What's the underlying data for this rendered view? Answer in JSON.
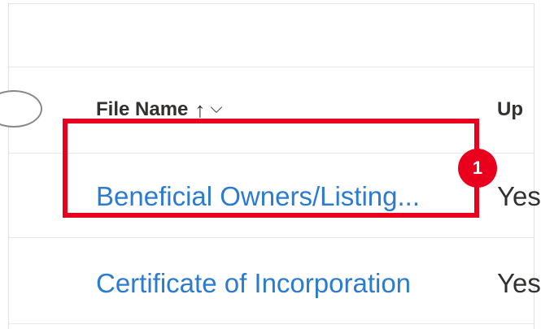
{
  "table": {
    "headers": {
      "file_name": "File Name",
      "upload": "Up",
      "sort_icon": "↑",
      "menu_icon": "⌵"
    },
    "rows": [
      {
        "file_name": "Beneficial Owners/Listing...",
        "upload": "Yes"
      },
      {
        "file_name": "Certificate of Incorporation",
        "upload": "Yes"
      }
    ]
  },
  "annotation": {
    "step_number": "1",
    "color": "#e8001c"
  },
  "colors": {
    "link": "#2b7bd1",
    "text": "#323130",
    "divider": "#e6e6e6"
  }
}
